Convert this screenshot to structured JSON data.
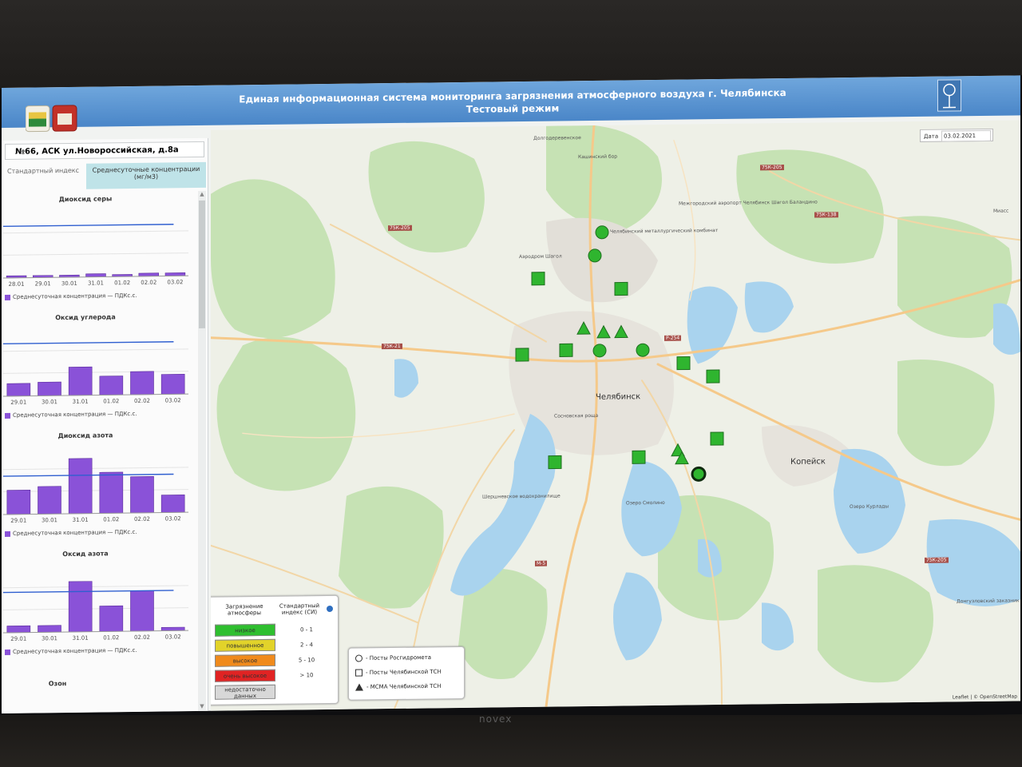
{
  "header": {
    "title": "Единая информационная система мониторинга загрязнения атмосферного воздуха г. Челябинска",
    "subtitle": "Тестовый режим"
  },
  "left_panel": {
    "station": "№66, АСК ул.Новороссийская, д.8а",
    "tabs": [
      "Стандартный индекс",
      "Среднесуточные концентрации (мг/м3)"
    ],
    "legend_avg": "Среднесуточная концентрация",
    "legend_limit": "ПДКс.с.",
    "ozone_title": "Озон"
  },
  "chart_data": [
    {
      "type": "bar",
      "title": "Диоксид серы",
      "categories": [
        "28.01",
        "29.01",
        "30.01",
        "31.01",
        "01.02",
        "02.02",
        "03.02"
      ],
      "values": [
        0.02,
        0.02,
        0.02,
        0.03,
        0.02,
        0.03,
        0.03
      ],
      "limit_line": 0.5,
      "ylim": [
        0,
        0.65
      ]
    },
    {
      "type": "bar",
      "title": "Оксид углерода",
      "categories": [
        "29.01",
        "30.01",
        "31.01",
        "01.02",
        "02.02",
        "03.02"
      ],
      "values": [
        0.6,
        0.65,
        1.35,
        0.9,
        1.1,
        0.95
      ],
      "limit_line": 2.5,
      "ylim": [
        0,
        3.2
      ]
    },
    {
      "type": "bar",
      "title": "Диоксид азота",
      "categories": [
        "29.01",
        "30.01",
        "31.01",
        "01.02",
        "02.02",
        "03.02"
      ],
      "values": [
        0.036,
        0.041,
        0.082,
        0.061,
        0.054,
        0.026
      ],
      "limit_line": 0.057,
      "ylim": [
        0,
        0.1
      ]
    },
    {
      "type": "bar",
      "title": "Оксид азота",
      "categories": [
        "29.01",
        "30.01",
        "31.01",
        "01.02",
        "02.02",
        "03.02"
      ],
      "values": [
        0.01,
        0.01,
        0.075,
        0.038,
        0.06,
        0.005
      ],
      "limit_line": 0.06,
      "ylim": [
        0,
        0.1
      ]
    }
  ],
  "map": {
    "date_label": "Дата",
    "date_value": "03.02.2021",
    "city": "Челябинск",
    "kopeysk": "Копейск",
    "place_labels": [
      "Долгодеревенское",
      "Кашинский бор",
      "Аэродром Шагол",
      "Челябинский металлургический комбинат",
      "Межгородский аэропорт Челябинск Шагол Баландино",
      "Шершневское водохранилище",
      "Озеро Смолино",
      "Озеро Курлады",
      "Донгузловский заказник",
      "Миасс",
      "Сосновская роща"
    ],
    "road_signs": [
      "75К-205",
      "75К-21",
      "Р-254",
      "75К-138",
      "М-5",
      "75К-205",
      "75К-205"
    ],
    "attribution": "Leaflet | © OpenStreetMap",
    "stations": [
      {
        "shape": "circle",
        "status": "low",
        "color": "#2fb52f"
      },
      {
        "shape": "circle",
        "status": "low",
        "color": "#2fb52f"
      },
      {
        "shape": "square",
        "status": "low",
        "color": "#2fb52f"
      },
      {
        "shape": "square",
        "status": "low",
        "color": "#2fb52f"
      },
      {
        "shape": "triangle",
        "status": "low",
        "color": "#2fb52f"
      },
      {
        "shape": "triangle",
        "status": "low",
        "color": "#2fb52f"
      },
      {
        "shape": "triangle",
        "status": "low",
        "color": "#2fb52f"
      },
      {
        "shape": "square",
        "status": "low",
        "color": "#2fb52f"
      },
      {
        "shape": "square",
        "status": "low",
        "color": "#2fb52f"
      },
      {
        "shape": "circle",
        "status": "low",
        "color": "#2fb52f"
      },
      {
        "shape": "circle",
        "status": "low",
        "color": "#2fb52f"
      },
      {
        "shape": "square",
        "status": "low",
        "color": "#2fb52f"
      },
      {
        "shape": "square",
        "status": "low",
        "color": "#2fb52f"
      },
      {
        "shape": "square",
        "status": "low",
        "color": "#2fb52f"
      },
      {
        "shape": "square",
        "status": "low",
        "color": "#2fb52f"
      },
      {
        "shape": "square",
        "status": "low",
        "color": "#2fb52f"
      },
      {
        "shape": "triangle",
        "status": "low",
        "color": "#2fb52f"
      },
      {
        "shape": "triangle",
        "status": "low",
        "color": "#2fb52f"
      },
      {
        "shape": "circle",
        "status": "low-selected",
        "color": "#2fb52f"
      }
    ]
  },
  "legend": {
    "col1": "Загрязнение атмосферы",
    "col2": "Стандартный индекс (СИ)",
    "levels": [
      {
        "label": "низкое",
        "range": "0 - 1",
        "color": "#2fbf2f"
      },
      {
        "label": "повышенное",
        "range": "2 - 4",
        "color": "#e2d32a"
      },
      {
        "label": "высокое",
        "range": "5 - 10",
        "color": "#f08a1c"
      },
      {
        "label": "очень высокое",
        "range": "> 10",
        "color": "#e02323"
      },
      {
        "label": "недостаточно данных",
        "range": "",
        "color": "#d8d8d8"
      }
    ]
  },
  "markers_legend": [
    {
      "label": "- Посты Росгидромета",
      "shape": "circle"
    },
    {
      "label": "- Посты Челябинской ТСН",
      "shape": "square"
    },
    {
      "label": "- МСМА Челябинской ТСН",
      "shape": "triangle"
    }
  ],
  "device": {
    "brand": "novex"
  }
}
